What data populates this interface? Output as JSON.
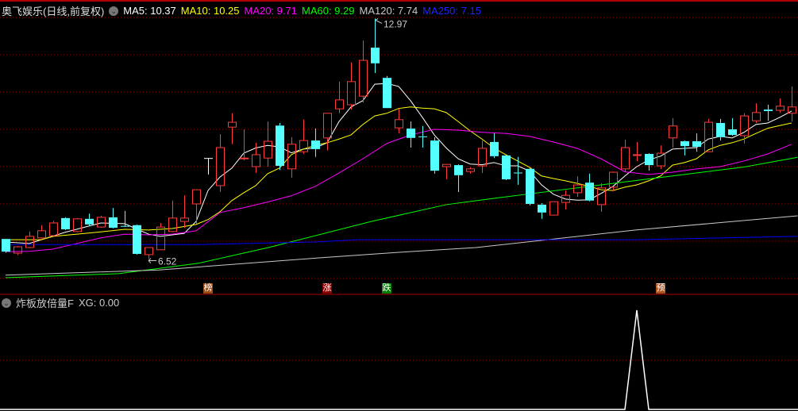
{
  "header": {
    "title": "奥飞娱乐(日线,前复权)",
    "ma": [
      {
        "label": "MA5: 10.37",
        "color": "#ffffff"
      },
      {
        "label": "MA10: 10.25",
        "color": "#ffff00"
      },
      {
        "label": "MA20: 9.71",
        "color": "#ff00ff"
      },
      {
        "label": "MA60: 9.29",
        "color": "#00ff00"
      },
      {
        "label": "MA120: 7.74",
        "color": "#c8c8c8"
      },
      {
        "label": "MA250: 7.15",
        "color": "#0000ff"
      }
    ]
  },
  "indicator": {
    "title": "炸板放倍量F",
    "xg_label": "XG: 0.00"
  },
  "markers": [
    {
      "text": "榜",
      "index": 17,
      "color": "#9a4a10"
    },
    {
      "text": "涨",
      "index": 27,
      "color": "#8b0000"
    },
    {
      "text": "跌",
      "index": 32,
      "color": "#008000"
    },
    {
      "text": "预",
      "index": 55,
      "color": "#b0501a"
    }
  ],
  "colors": {
    "up": "#ff3b3b",
    "down": "#54ffff",
    "flat": "#ffffff",
    "grid": "#8b0000"
  },
  "chart_data": {
    "type": "candlestick",
    "price_range": [
      6,
      13
    ],
    "gridlines": [
      6,
      7,
      8,
      9,
      10,
      11,
      12,
      13
    ],
    "high_label": "12.97",
    "high_index": 31,
    "low_label": "6.52",
    "low_index": 12,
    "candles": [
      [
        7.06,
        7.06,
        6.69,
        6.72
      ],
      [
        6.68,
        6.87,
        6.63,
        6.85
      ],
      [
        6.83,
        7.26,
        6.81,
        7.13
      ],
      [
        7.09,
        7.43,
        7.07,
        7.28
      ],
      [
        7.15,
        7.55,
        7.13,
        7.49
      ],
      [
        7.62,
        7.64,
        7.3,
        7.32
      ],
      [
        7.26,
        7.62,
        7.24,
        7.6
      ],
      [
        7.6,
        7.74,
        7.4,
        7.45
      ],
      [
        7.38,
        7.68,
        7.36,
        7.64
      ],
      [
        7.64,
        7.89,
        7.34,
        7.36
      ],
      [
        7.41,
        7.81,
        7.38,
        7.39
      ],
      [
        7.43,
        7.45,
        6.64,
        6.66
      ],
      [
        6.64,
        6.83,
        6.52,
        6.83
      ],
      [
        6.77,
        7.49,
        6.77,
        7.38
      ],
      [
        7.26,
        8.09,
        7.24,
        7.62
      ],
      [
        7.53,
        8.23,
        7.36,
        7.62
      ],
      [
        8.0,
        8.38,
        7.47,
        8.38
      ],
      [
        9.23,
        9.23,
        8.79,
        9.23
      ],
      [
        8.49,
        9.87,
        8.32,
        9.51
      ],
      [
        10.06,
        10.43,
        9.6,
        10.19
      ],
      [
        9.21,
        10.0,
        9.17,
        9.23
      ],
      [
        9.0,
        9.64,
        8.83,
        9.32
      ],
      [
        9.23,
        10.21,
        9.0,
        9.68
      ],
      [
        10.1,
        10.17,
        8.91,
        9.02
      ],
      [
        8.94,
        9.79,
        8.7,
        9.6
      ],
      [
        9.4,
        10.26,
        9.34,
        9.7
      ],
      [
        9.7,
        10.02,
        9.26,
        9.47
      ],
      [
        9.77,
        10.43,
        9.43,
        10.43
      ],
      [
        10.55,
        11.28,
        10.43,
        10.79
      ],
      [
        10.66,
        11.79,
        10.53,
        11.28
      ],
      [
        10.89,
        12.38,
        10.72,
        11.85
      ],
      [
        12.19,
        12.97,
        11.51,
        11.77
      ],
      [
        11.38,
        11.43,
        10.57,
        10.57
      ],
      [
        10.04,
        10.55,
        9.89,
        10.26
      ],
      [
        10.02,
        10.21,
        9.51,
        9.77
      ],
      [
        9.81,
        10.09,
        9.51,
        9.79
      ],
      [
        9.7,
        9.79,
        8.81,
        8.89
      ],
      [
        9.0,
        9.06,
        8.66,
        9.06
      ],
      [
        9.04,
        9.06,
        8.32,
        8.77
      ],
      [
        8.87,
        8.98,
        8.81,
        8.94
      ],
      [
        9.02,
        9.7,
        8.83,
        9.49
      ],
      [
        9.66,
        9.89,
        9.23,
        9.28
      ],
      [
        9.3,
        9.3,
        8.64,
        8.66
      ],
      [
        8.84,
        9.26,
        8.51,
        8.82
      ],
      [
        8.94,
        8.96,
        7.96,
        8.0
      ],
      [
        7.98,
        8.02,
        7.6,
        7.77
      ],
      [
        7.7,
        8.06,
        7.7,
        8.06
      ],
      [
        8.04,
        8.36,
        7.85,
        8.23
      ],
      [
        8.3,
        8.74,
        8.19,
        8.51
      ],
      [
        8.57,
        8.81,
        8.07,
        8.09
      ],
      [
        7.98,
        8.55,
        7.79,
        8.43
      ],
      [
        8.45,
        8.87,
        8.34,
        8.85
      ],
      [
        8.94,
        9.72,
        8.85,
        9.51
      ],
      [
        9.3,
        9.66,
        9.15,
        9.32
      ],
      [
        9.34,
        9.36,
        8.89,
        9.04
      ],
      [
        9.02,
        9.57,
        8.94,
        9.36
      ],
      [
        9.77,
        10.3,
        9.51,
        10.09
      ],
      [
        9.68,
        9.7,
        9.3,
        9.55
      ],
      [
        9.68,
        9.89,
        9.4,
        9.53
      ],
      [
        9.4,
        10.28,
        9.4,
        10.19
      ],
      [
        10.17,
        10.28,
        9.7,
        9.79
      ],
      [
        10.0,
        10.3,
        9.83,
        9.85
      ],
      [
        9.83,
        10.43,
        9.62,
        10.36
      ],
      [
        10.23,
        10.7,
        10.17,
        10.45
      ],
      [
        10.53,
        10.66,
        10.23,
        10.49
      ],
      [
        10.51,
        10.83,
        10.45,
        10.62
      ],
      [
        10.43,
        11.15,
        10.21,
        10.6
      ]
    ],
    "ma_lines": [
      {
        "name": "MA5",
        "color": "#ffffff",
        "points": [
          [
            0,
            6.98
          ],
          [
            2,
            6.94
          ],
          [
            5,
            7.24
          ],
          [
            8,
            7.49
          ],
          [
            10,
            7.47
          ],
          [
            11,
            7.33
          ],
          [
            12,
            7.19
          ],
          [
            13,
            7.13
          ],
          [
            14,
            7.17
          ],
          [
            15,
            7.21
          ],
          [
            16,
            7.53
          ],
          [
            17,
            8.36
          ],
          [
            18,
            8.72
          ],
          [
            19,
            8.96
          ],
          [
            20,
            9.36
          ],
          [
            21,
            9.5
          ],
          [
            22,
            9.57
          ],
          [
            23,
            9.53
          ],
          [
            24,
            9.37
          ],
          [
            25,
            9.47
          ],
          [
            26,
            9.5
          ],
          [
            27,
            9.64
          ],
          [
            28,
            10.21
          ],
          [
            29,
            10.6
          ],
          [
            30,
            10.77
          ],
          [
            31,
            11.21
          ],
          [
            32,
            11.23
          ],
          [
            33,
            11.15
          ],
          [
            34,
            10.77
          ],
          [
            35,
            10.32
          ],
          [
            36,
            9.85
          ],
          [
            37,
            9.5
          ],
          [
            38,
            9.21
          ],
          [
            39,
            9.07
          ],
          [
            40,
            9.05
          ],
          [
            41,
            9.11
          ],
          [
            42,
            9.02
          ],
          [
            43,
            9.02
          ],
          [
            44,
            8.88
          ],
          [
            45,
            8.51
          ],
          [
            46,
            8.26
          ],
          [
            47,
            8.13
          ],
          [
            48,
            8.1
          ],
          [
            49,
            8.11
          ],
          [
            50,
            8.28
          ],
          [
            51,
            8.47
          ],
          [
            52,
            8.75
          ],
          [
            53,
            9.0
          ],
          [
            54,
            9.18
          ],
          [
            55,
            9.28
          ],
          [
            56,
            9.47
          ],
          [
            57,
            9.49
          ],
          [
            58,
            9.51
          ],
          [
            59,
            9.74
          ],
          [
            60,
            9.81
          ],
          [
            61,
            9.77
          ],
          [
            62,
            9.92
          ],
          [
            63,
            10.13
          ],
          [
            64,
            10.17
          ],
          [
            65,
            10.32
          ],
          [
            66,
            10.49
          ]
        ]
      },
      {
        "name": "MA10",
        "color": "#ffff00",
        "points": [
          [
            0,
            7.04
          ],
          [
            3,
            7.04
          ],
          [
            4,
            7.13
          ],
          [
            6,
            7.19
          ],
          [
            8,
            7.25
          ],
          [
            10,
            7.32
          ],
          [
            12,
            7.3
          ],
          [
            14,
            7.34
          ],
          [
            16,
            7.45
          ],
          [
            17,
            7.58
          ],
          [
            18,
            7.79
          ],
          [
            19,
            8.09
          ],
          [
            20,
            8.3
          ],
          [
            21,
            8.49
          ],
          [
            22,
            8.81
          ],
          [
            23,
            8.96
          ],
          [
            24,
            9.32
          ],
          [
            25,
            9.47
          ],
          [
            26,
            9.57
          ],
          [
            27,
            9.64
          ],
          [
            28,
            9.74
          ],
          [
            29,
            9.85
          ],
          [
            30,
            10.13
          ],
          [
            31,
            10.36
          ],
          [
            32,
            10.43
          ],
          [
            33,
            10.56
          ],
          [
            34,
            10.6
          ],
          [
            35,
            10.57
          ],
          [
            36,
            10.55
          ],
          [
            37,
            10.45
          ],
          [
            38,
            10.21
          ],
          [
            39,
            9.96
          ],
          [
            40,
            9.74
          ],
          [
            41,
            9.5
          ],
          [
            42,
            9.32
          ],
          [
            43,
            9.15
          ],
          [
            44,
            8.98
          ],
          [
            45,
            8.75
          ],
          [
            46,
            8.68
          ],
          [
            47,
            8.62
          ],
          [
            48,
            8.55
          ],
          [
            49,
            8.47
          ],
          [
            50,
            8.38
          ],
          [
            51,
            8.36
          ],
          [
            52,
            8.45
          ],
          [
            53,
            8.51
          ],
          [
            54,
            8.62
          ],
          [
            55,
            8.75
          ],
          [
            56,
            9.04
          ],
          [
            57,
            9.11
          ],
          [
            58,
            9.21
          ],
          [
            59,
            9.45
          ],
          [
            60,
            9.57
          ],
          [
            61,
            9.64
          ],
          [
            62,
            9.74
          ],
          [
            63,
            9.89
          ],
          [
            64,
            10.03
          ],
          [
            65,
            10.1
          ],
          [
            66,
            10.17
          ]
        ]
      },
      {
        "name": "MA20",
        "color": "#ff00ff",
        "points": [
          [
            0,
            6.72
          ],
          [
            2,
            6.73
          ],
          [
            4,
            6.79
          ],
          [
            6,
            6.94
          ],
          [
            8,
            7.09
          ],
          [
            10,
            7.19
          ],
          [
            12,
            7.17
          ],
          [
            14,
            7.19
          ],
          [
            16,
            7.28
          ],
          [
            18,
            7.77
          ],
          [
            20,
            7.9
          ],
          [
            22,
            8.05
          ],
          [
            24,
            8.22
          ],
          [
            26,
            8.47
          ],
          [
            28,
            8.83
          ],
          [
            30,
            9.21
          ],
          [
            32,
            9.62
          ],
          [
            34,
            9.85
          ],
          [
            36,
            10.0
          ],
          [
            38,
            9.98
          ],
          [
            40,
            9.92
          ],
          [
            42,
            9.89
          ],
          [
            44,
            9.81
          ],
          [
            46,
            9.66
          ],
          [
            48,
            9.49
          ],
          [
            50,
            9.21
          ],
          [
            52,
            8.86
          ],
          [
            54,
            8.79
          ],
          [
            56,
            8.85
          ],
          [
            58,
            8.94
          ],
          [
            60,
            9.0
          ],
          [
            62,
            9.15
          ],
          [
            64,
            9.34
          ],
          [
            66,
            9.6
          ]
        ]
      },
      {
        "name": "MA60",
        "color": "#00ff00",
        "points": [
          [
            0,
            6.02
          ],
          [
            9.5,
            6.13
          ],
          [
            16.2,
            6.41
          ],
          [
            22.2,
            6.84
          ],
          [
            30.7,
            7.53
          ],
          [
            37,
            7.98
          ],
          [
            41.5,
            8.17
          ],
          [
            44,
            8.27
          ],
          [
            50,
            8.51
          ],
          [
            56,
            8.75
          ],
          [
            62,
            8.99
          ],
          [
            66.5,
            9.25
          ]
        ]
      },
      {
        "name": "MA120",
        "color": "#c8c8c8",
        "points": [
          [
            0,
            6.09
          ],
          [
            12.9,
            6.23
          ],
          [
            26.2,
            6.55
          ],
          [
            32.9,
            6.7
          ],
          [
            39.5,
            6.83
          ],
          [
            52.9,
            7.3
          ],
          [
            66.5,
            7.68
          ]
        ]
      },
      {
        "name": "MA250",
        "color": "#0000ff",
        "points": [
          [
            0,
            6.91
          ],
          [
            16,
            6.91
          ],
          [
            26,
            6.98
          ],
          [
            29.5,
            7.04
          ],
          [
            36,
            7.04
          ],
          [
            53,
            7.04
          ],
          [
            66.5,
            7.13
          ]
        ]
      }
    ],
    "indicator_series": {
      "name": "XG",
      "range": [
        0,
        1
      ],
      "values_nonzero": {
        "53": 1
      },
      "count": 67
    }
  }
}
